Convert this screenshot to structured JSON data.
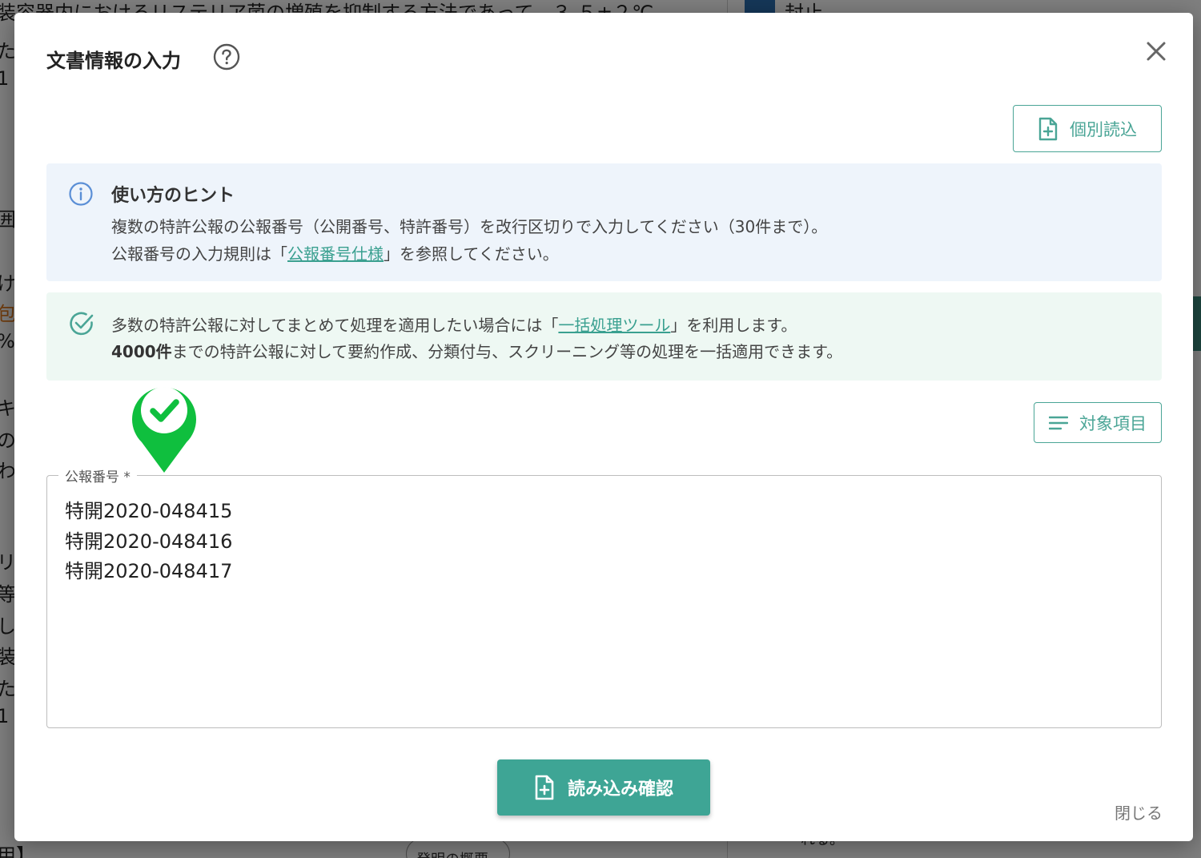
{
  "background": {
    "top_text": "装容器内におけるリステリア菌の増殖を抑制する方法であって、３.５±２℃",
    "right_top_text": "封止",
    "left_column": [
      "た",
      "1",
      "囲",
      "け",
      "包",
      "%",
      "キ",
      "の",
      "わ",
      "リ",
      "等",
      "し",
      "装",
      "た",
      "1",
      "用】"
    ],
    "chip_label": "発明の概要",
    "bottom_right_text": "れる。"
  },
  "modal": {
    "title": "文書情報の入力",
    "help_icon": "question-circle-icon",
    "close_icon": "close-icon",
    "individual_button_label": "個別読込",
    "hint": {
      "title": "使い方のヒント",
      "line1": "複数の特許公報の公報番号（公開番号、特許番号）を改行区切りで入力してください（30件まで）。",
      "line2_prefix": "公報番号の入力規則は「",
      "line2_link": "公報番号仕様",
      "line2_suffix": "」を参照してください。"
    },
    "batch": {
      "line1_prefix": "多数の特許公報に対してまとめて処理を適用したい場合には「",
      "line1_link": "一括処理ツール",
      "line1_suffix": "」を利用します。",
      "line2_bold": "4000件",
      "line2_rest": "までの特許公報に対して要約作成、分類付与、スクリーニング等の処理を一括適用できます。"
    },
    "target_button_label": "対象項目",
    "field_label": "公報番号 *",
    "field_value": "特開2020-048415\n特開2020-048416\n特開2020-048417",
    "confirm_button_label": "読み込み確認",
    "close_link_label": "閉じる"
  },
  "colors": {
    "accent": "#3ea595",
    "hint_bg": "#eef4fb",
    "batch_bg": "#eef8f3",
    "marker": "#0fbf3e"
  }
}
